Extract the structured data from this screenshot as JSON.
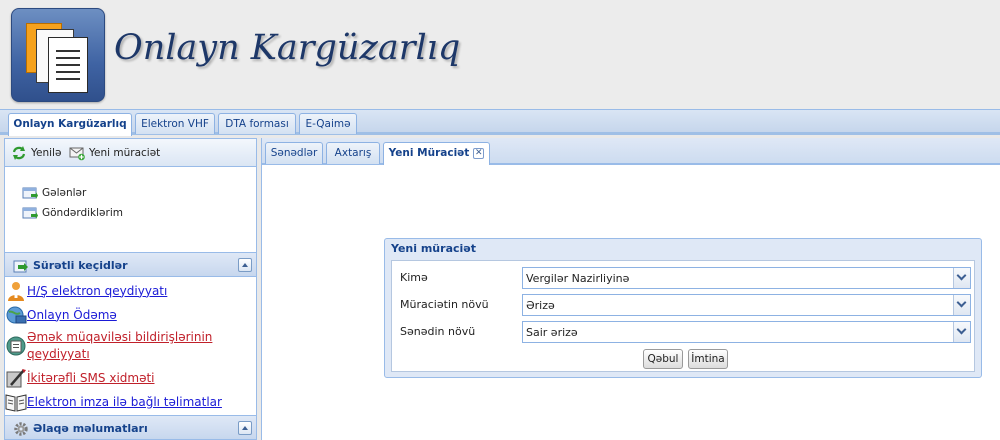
{
  "app": {
    "title": "Onlayn Kargüzarlıq"
  },
  "top_tabs": [
    {
      "label": "Onlayn Kargüzarlıq",
      "active": true
    },
    {
      "label": "Elektron VHF",
      "active": false
    },
    {
      "label": "DTA forması",
      "active": false
    },
    {
      "label": "E-Qaimə",
      "active": false
    }
  ],
  "left_toolbar": {
    "refresh_label": "Yenilə",
    "new_request_label": "Yeni müraciət"
  },
  "folders": [
    {
      "label": "Gələnlər"
    },
    {
      "label": "Göndərdiklərim"
    }
  ],
  "quick_links": {
    "title": "Sürətli keçidlər",
    "items": [
      {
        "label": "H/Ş elektron qeydiyyatı",
        "color": "#1a1ad6"
      },
      {
        "label": "Onlayn Ödəmə",
        "color": "#1a1ad6"
      },
      {
        "label": "Əmək müqaviləsi bildirişlərinin",
        "color": "#c0202a"
      },
      {
        "label": "qeydiyyatı",
        "color": "#c0202a"
      },
      {
        "label": "İkitərəfli SMS xidməti",
        "color": "#c0202a"
      },
      {
        "label": "Elektron imza ilə bağlı təlimatlar",
        "color": "#1a1ad6"
      }
    ]
  },
  "contact_section": {
    "title": "Əlaqə məlumatları"
  },
  "inner_tabs": [
    {
      "label": "Sənədlər",
      "active": false
    },
    {
      "label": "Axtarış",
      "active": false
    },
    {
      "label": "Yeni Müraciət",
      "active": true,
      "closable": true
    }
  ],
  "dialog": {
    "title": "Yeni müraciət",
    "fields": [
      {
        "label": "Kimə",
        "value": "Vergilər Nazirliyinə"
      },
      {
        "label": "Müraciətin növü",
        "value": "Ərizə"
      },
      {
        "label": "Sənədin növü",
        "value": "Sair ərizə"
      }
    ],
    "accept_label": "Qəbul",
    "cancel_label": "İmtina"
  }
}
